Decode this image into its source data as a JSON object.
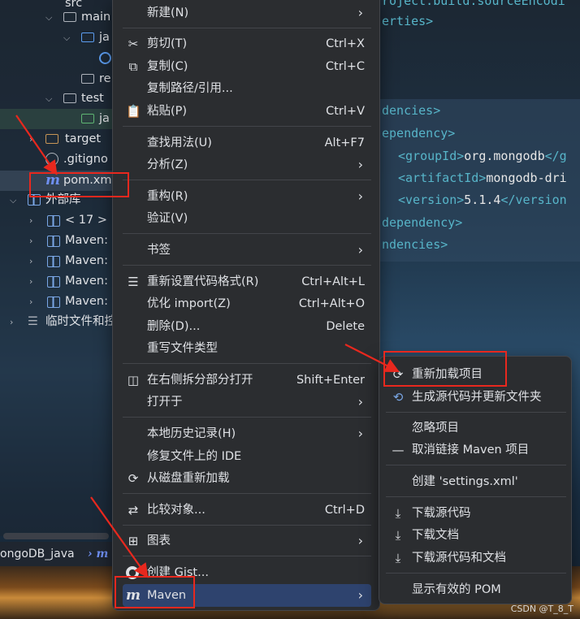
{
  "tree": {
    "items": [
      {
        "label": "src"
      },
      {
        "label": "main"
      },
      {
        "label": "ja"
      },
      {
        "label": "re"
      },
      {
        "label": "test"
      },
      {
        "label": "ja"
      },
      {
        "label": "target"
      },
      {
        "label": ".gitigno"
      },
      {
        "label": "pom.xm"
      },
      {
        "label": "外部库"
      },
      {
        "label": "< 17 >"
      },
      {
        "label": "Maven:"
      },
      {
        "label": "Maven:"
      },
      {
        "label": "Maven:"
      },
      {
        "label": "Maven:"
      },
      {
        "label": "临时文件和控"
      }
    ],
    "breadcrumb": "ongoDB_java"
  },
  "code": {
    "lines": [
      {
        "text": "roject.build.sourceEncodi"
      },
      {
        "text": "erties>"
      },
      {
        "text": "dencies>"
      },
      {
        "text": "ependency>"
      },
      {
        "open": "<groupId>",
        "value": "org.mongodb",
        "close": "</g"
      },
      {
        "open": "<artifactId>",
        "value": "mongodb-dri",
        "close": ""
      },
      {
        "open": "<version>",
        "value": "5.1.4",
        "close": "</version"
      },
      {
        "text": "dependency>"
      },
      {
        "text": "ndencies>"
      }
    ]
  },
  "menu": {
    "new": {
      "label": "新建(N)"
    },
    "cut": {
      "label": "剪切(T)",
      "shortcut": "Ctrl+X"
    },
    "copy": {
      "label": "复制(C)",
      "shortcut": "Ctrl+C"
    },
    "copy_path": {
      "label": "复制路径/引用..."
    },
    "paste": {
      "label": "粘贴(P)",
      "shortcut": "Ctrl+V"
    },
    "find_usages": {
      "label": "查找用法(U)",
      "shortcut": "Alt+F7"
    },
    "analyze": {
      "label": "分析(Z)"
    },
    "refactor": {
      "label": "重构(R)"
    },
    "verify": {
      "label": "验证(V)"
    },
    "bookmarks": {
      "label": "书签"
    },
    "reformat": {
      "label": "重新设置代码格式(R)",
      "shortcut": "Ctrl+Alt+L"
    },
    "optimize_imports": {
      "label": "优化 import(Z)",
      "shortcut": "Ctrl+Alt+O"
    },
    "delete": {
      "label": "删除(D)...",
      "shortcut": "Delete"
    },
    "override_type": {
      "label": "重写文件类型"
    },
    "split_right": {
      "label": "在右侧拆分部分打开",
      "shortcut": "Shift+Enter"
    },
    "open_in": {
      "label": "打开于"
    },
    "local_history": {
      "label": "本地历史记录(H)"
    },
    "repair_ide": {
      "label": "修复文件上的 IDE"
    },
    "reload_disk": {
      "label": "从磁盘重新加载"
    },
    "compare": {
      "label": "比较对象...",
      "shortcut": "Ctrl+D"
    },
    "diagrams": {
      "label": "图表"
    },
    "gist": {
      "label": "创建 Gist..."
    },
    "maven": {
      "label": "Maven"
    }
  },
  "submenu": {
    "reload_project": "重新加载项目",
    "generate_sources": "生成源代码并更新文件夹",
    "ignore_project": "忽略项目",
    "unlink_project": "取消链接 Maven 项目",
    "create_settings": "创建 'settings.xml'",
    "download_sources": "下载源代码",
    "download_docs": "下载文档",
    "download_both": "下载源代码和文档",
    "effective_pom": "显示有效的 POM"
  },
  "watermark": "CSDN @T_8_T",
  "colors": {
    "annotation_red": "#e8281e",
    "menu_bg": "#2b2d30",
    "active_item": "#2e436e",
    "maven_icon": "#6f8ff2"
  }
}
